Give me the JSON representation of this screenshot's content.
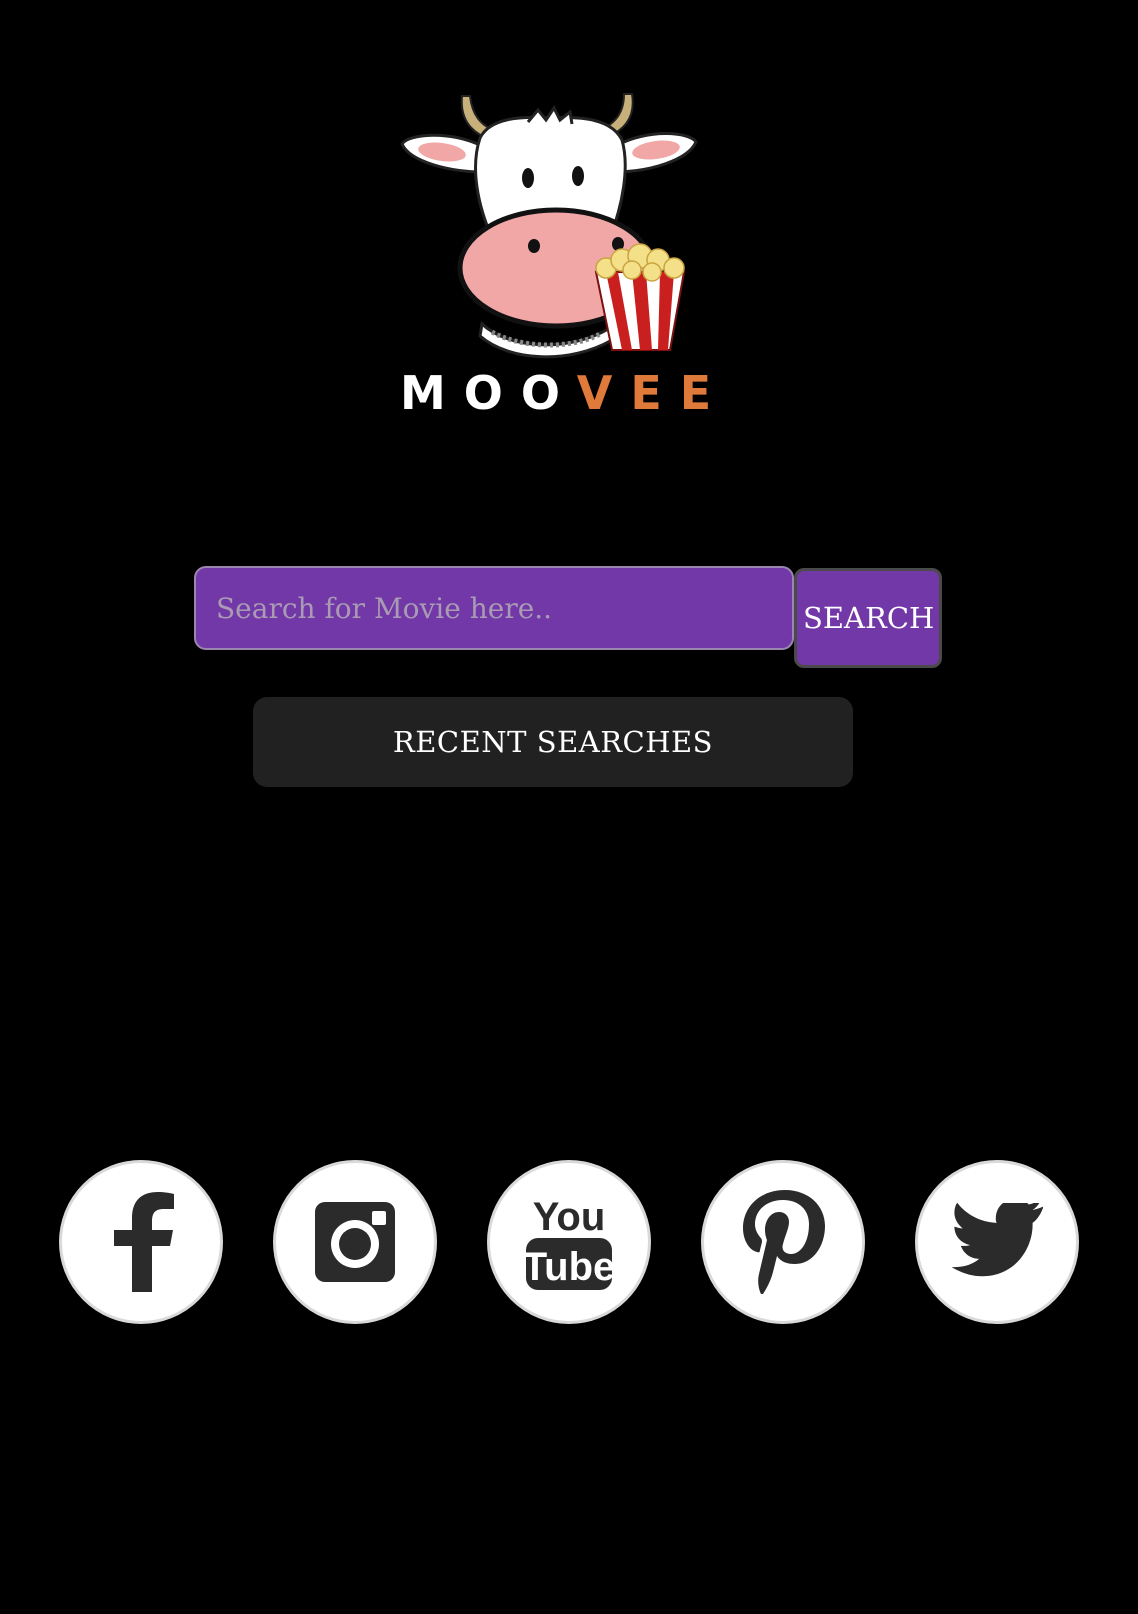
{
  "brand": {
    "name_main": "MOO",
    "name_accent": "VEE",
    "accent_color": "#e07a3a"
  },
  "search": {
    "placeholder": "Search for Movie here..",
    "value": "",
    "button_label": "SEARCH",
    "color": "#7338a8"
  },
  "recent": {
    "label": "RECENT SEARCHES"
  },
  "social": [
    {
      "name": "facebook",
      "icon": "facebook-icon"
    },
    {
      "name": "instagram",
      "icon": "instagram-icon"
    },
    {
      "name": "youtube",
      "icon": "youtube-icon",
      "text_top": "You",
      "text_bottom": "Tube"
    },
    {
      "name": "pinterest",
      "icon": "pinterest-icon"
    },
    {
      "name": "twitter",
      "icon": "twitter-icon"
    }
  ]
}
